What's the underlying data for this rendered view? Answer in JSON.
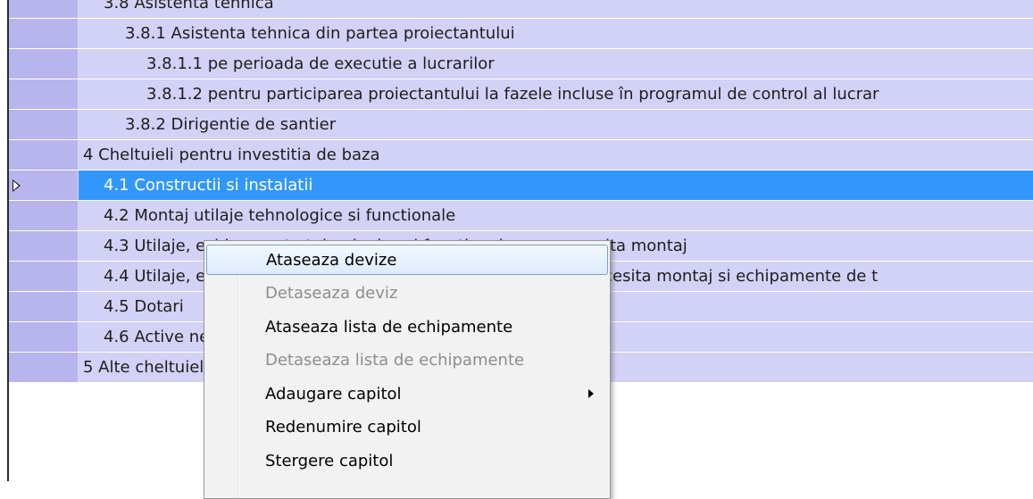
{
  "rows": [
    {
      "label": "3.8 Asistenta tehnica",
      "level": 2,
      "selected": false
    },
    {
      "label": "3.8.1 Asistenta tehnica din partea proiectantului",
      "level": 3,
      "selected": false
    },
    {
      "label": "3.8.1.1 pe perioada de executie a lucrarilor",
      "level": 4,
      "selected": false
    },
    {
      "label": "3.8.1.2 pentru participarea proiectantului la fazele incluse în programul de control al lucrar",
      "level": 4,
      "selected": false
    },
    {
      "label": "3.8.2 Dirigentie de santier",
      "level": 3,
      "selected": false
    },
    {
      "label": "4 Cheltuieli pentru investitia de baza",
      "level": 1,
      "selected": false
    },
    {
      "label": "4.1 Constructii si instalatii",
      "level": 2,
      "selected": true
    },
    {
      "label": "4.2 Montaj utilaje tehnologice si functionale",
      "level": 2,
      "selected": false
    },
    {
      "label": "4.3 Utilaje, echipamente tehnologice si functionale care necesita montaj",
      "level": 2,
      "selected": false
    },
    {
      "label": "4.4 Utilaje, echipamente tehnologice si functionale care nu necesita montaj si echipamente de t",
      "level": 2,
      "selected": false
    },
    {
      "label": "4.5 Dotari",
      "level": 2,
      "selected": false
    },
    {
      "label": "4.6 Active necorporale",
      "level": 2,
      "selected": false
    },
    {
      "label": "5 Alte cheltuieli",
      "level": 1,
      "selected": false
    }
  ],
  "context_menu": {
    "items": [
      {
        "label": "Ataseaza devize",
        "enabled": true,
        "highlighted": true,
        "submenu": false
      },
      {
        "label": "Detaseaza deviz",
        "enabled": false,
        "highlighted": false,
        "submenu": false
      },
      {
        "label": "Ataseaza lista de echipamente",
        "enabled": true,
        "highlighted": false,
        "submenu": false
      },
      {
        "label": "Detaseaza lista de echipamente",
        "enabled": false,
        "highlighted": false,
        "submenu": false
      },
      {
        "label": "Adaugare capitol",
        "enabled": true,
        "highlighted": false,
        "submenu": true
      },
      {
        "label": "Redenumire capitol",
        "enabled": true,
        "highlighted": false,
        "submenu": false
      },
      {
        "label": "Stergere capitol",
        "enabled": true,
        "highlighted": false,
        "submenu": false
      }
    ]
  }
}
